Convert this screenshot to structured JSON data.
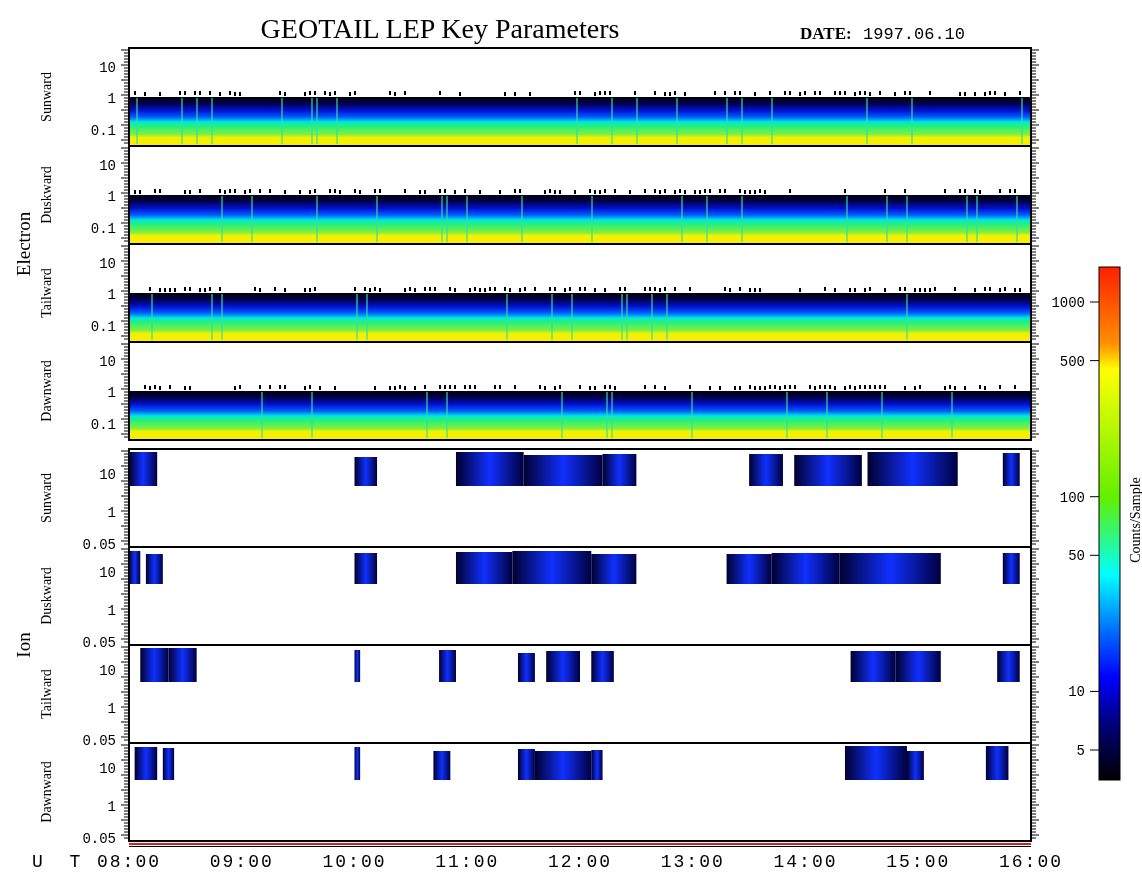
{
  "title": "GEOTAIL LEP Key Parameters",
  "date": {
    "label": "DATE:",
    "value": "1997.06.10"
  },
  "groups": [
    {
      "label": "Electron",
      "kind": "electron",
      "panels": [
        {
          "label": "Sunward",
          "yticks": [
            "10",
            "1",
            "0.1"
          ]
        },
        {
          "label": "Duskward",
          "yticks": [
            "10",
            "1",
            "0.1"
          ]
        },
        {
          "label": "Tailward",
          "yticks": [
            "10",
            "1",
            "0.1"
          ]
        },
        {
          "label": "Dawnward",
          "yticks": [
            "10",
            "1",
            "0.1"
          ]
        }
      ]
    },
    {
      "label": "Ion",
      "kind": "ion",
      "panels": [
        {
          "label": "Sunward",
          "yticks": [
            "10",
            "1",
            "0.05"
          ]
        },
        {
          "label": "Duskward",
          "yticks": [
            "10",
            "1",
            "0.05"
          ]
        },
        {
          "label": "Tailward",
          "yticks": [
            "10",
            "1",
            "0.05"
          ]
        },
        {
          "label": "Dawnward",
          "yticks": [
            "10",
            "1",
            "0.05"
          ]
        }
      ]
    }
  ],
  "colorbar": {
    "label": "Counts/Sample",
    "ticks": [
      "1000",
      "500",
      "100",
      "50",
      "10",
      "5"
    ]
  },
  "time_axis": {
    "label": "U T",
    "ticks": [
      "08:00",
      "09:00",
      "10:00",
      "11:00",
      "12:00",
      "13:00",
      "14:00",
      "15:00",
      "16:00"
    ]
  }
}
